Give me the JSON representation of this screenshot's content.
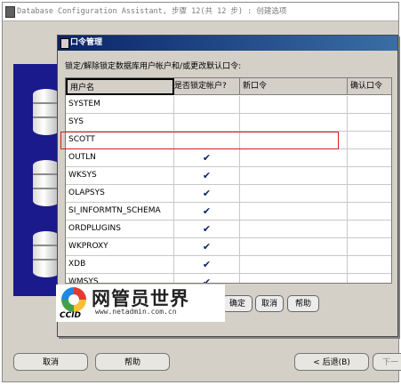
{
  "main_window": {
    "title": "Database Configuration Assistant, 步骤 12(共 12 步) : 创建选项",
    "buttons": {
      "cancel": "取消",
      "help": "帮助",
      "back": "< 后退(B)",
      "next": "下一"
    }
  },
  "dialog": {
    "title": "口令管理",
    "instruction": "锁定/解除锁定数据库用户帐户和/或更改默认口令:",
    "columns": [
      "用户名",
      "是否锁定帐户?",
      "新口令",
      "确认口令"
    ],
    "rows": [
      {
        "user": "SYSTEM",
        "locked": false
      },
      {
        "user": "SYS",
        "locked": false
      },
      {
        "user": "SCOTT",
        "locked": false
      },
      {
        "user": "OUTLN",
        "locked": true
      },
      {
        "user": "WKSYS",
        "locked": true
      },
      {
        "user": "OLAPSYS",
        "locked": true
      },
      {
        "user": "SI_INFORMTN_SCHEMA",
        "locked": true
      },
      {
        "user": "ORDPLUGINS",
        "locked": true
      },
      {
        "user": "WKPROXY",
        "locked": true
      },
      {
        "user": "XDB",
        "locked": true
      },
      {
        "user": "WMSYS",
        "locked": true
      }
    ],
    "check_glyph": "✔",
    "buttons": {
      "ok": "确定",
      "cancel": "取消",
      "help": "帮助"
    },
    "behind_button": "退出"
  },
  "watermark": {
    "title": "网管员世界",
    "brand": "CCID",
    "url": "www.netadmin.com.cn"
  },
  "colors": {
    "titlebar_start": "#0a246a",
    "titlebar_end": "#3a6ea5",
    "selection_outline": "#cc2020",
    "side_panel": "#1a1a8c"
  }
}
